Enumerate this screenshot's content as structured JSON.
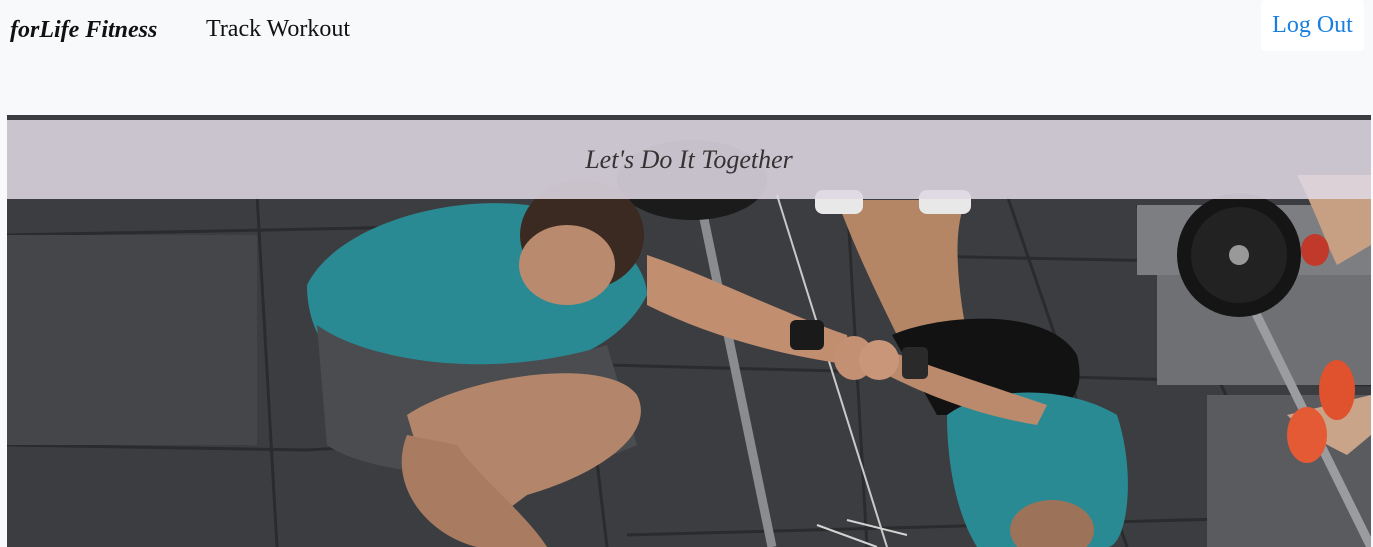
{
  "navbar": {
    "brand": "forLife Fitness",
    "links": [
      {
        "label": "Track Workout"
      }
    ],
    "logout_label": "Log Out",
    "logout_color": "#1a7ee0"
  },
  "hero": {
    "title": "Let's Do It Together",
    "image_subject": "two-athletes-fist-bump-photo"
  }
}
